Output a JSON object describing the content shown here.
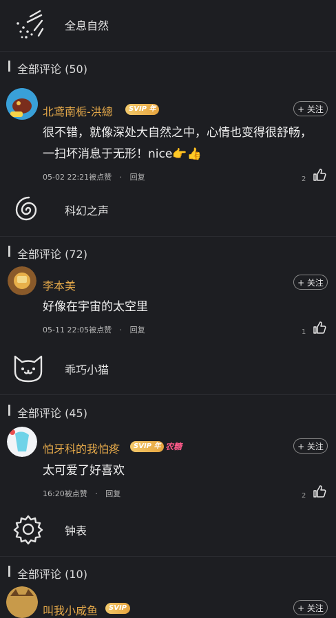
{
  "blocks": [
    {
      "sound": {
        "name": "全息自然",
        "icon": "meteor-shower-icon"
      },
      "section_title": "全部评论 (50)",
      "comment": {
        "user": "北鸢南栀-洪總",
        "badge": "SVIP",
        "badge_year": "年",
        "extra_badge": "",
        "follow": "+ 关注",
        "text": "很不错，就像深处大自然之中，心情也变得很舒畅，一扫坏消息于无形！nice👉👍",
        "time": "05-02 22:21被点赞",
        "reply": "回复",
        "likes": "2"
      }
    },
    {
      "sound": {
        "name": "科幻之声",
        "icon": "spiral-icon"
      },
      "section_title": "全部评论 (72)",
      "comment": {
        "user": "李本美",
        "badge": "",
        "badge_year": "",
        "extra_badge": "",
        "follow": "+ 关注",
        "text": "好像在宇宙的太空里",
        "time": "05-11 22:05被点赞",
        "reply": "回复",
        "likes": "1"
      }
    },
    {
      "sound": {
        "name": "乖巧小猫",
        "icon": "cat-icon"
      },
      "section_title": "全部评论 (45)",
      "comment": {
        "user": "怕牙科的我怕疼",
        "badge": "SVIP",
        "badge_year": "年",
        "extra_badge": "农糖",
        "follow": "+ 关注",
        "text": "太可爱了好喜欢",
        "time": "16:20被点赞",
        "reply": "回复",
        "likes": "2"
      }
    },
    {
      "sound": {
        "name": "钟表",
        "icon": "gear-icon"
      },
      "section_title": "全部评论 (10)",
      "comment": {
        "user": "叫我小咸鱼",
        "badge": "SVIP",
        "follow": "+ 关注"
      }
    }
  ]
}
